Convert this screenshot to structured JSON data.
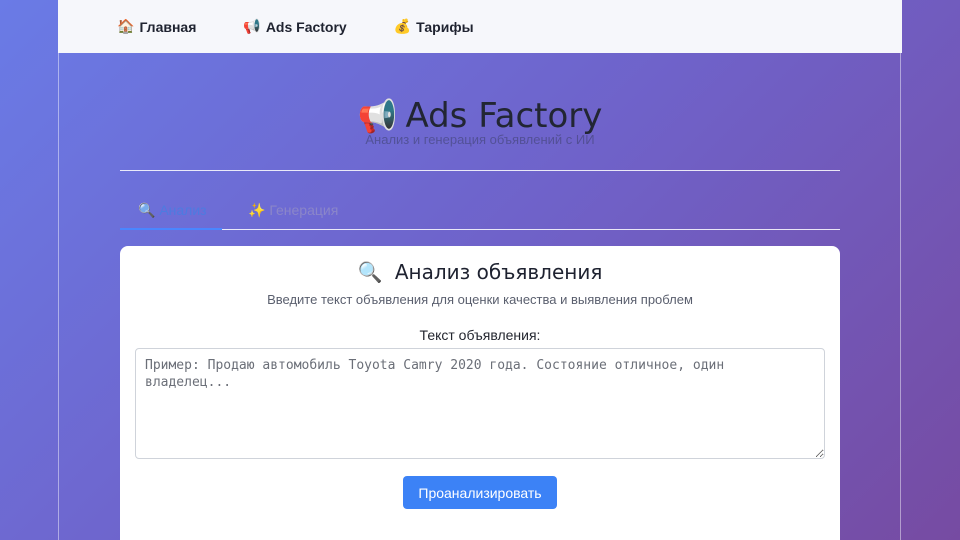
{
  "nav": {
    "items": [
      {
        "icon": "🏠",
        "icon_name": "home-icon",
        "label": "Главная"
      },
      {
        "icon": "📢",
        "icon_name": "megaphone-icon",
        "label": "Ads Factory"
      },
      {
        "icon": "💰",
        "icon_name": "money-bag-icon",
        "label": "Тарифы"
      }
    ]
  },
  "hero": {
    "icon": "📢",
    "title": "Ads Factory",
    "subtitle": "Анализ и генерация объявлений с ИИ"
  },
  "tabs": [
    {
      "icon": "🔍",
      "label": "Анализ",
      "active": true
    },
    {
      "icon": "✨",
      "label": "Генерация",
      "active": false
    }
  ],
  "card": {
    "icon": "🔍",
    "title": "Анализ объявления",
    "description": "Введите текст объявления для оценки качества и выявления проблем",
    "field_label": "Текст объявления:",
    "textarea_value": "",
    "textarea_placeholder": "Пример: Продаю автомобиль Toyota Camry 2020 года. Состояние отличное, один владелец...",
    "button_label": "Проанализировать"
  },
  "colors": {
    "gradient_start": "#6a7be6",
    "gradient_end": "#764ba2",
    "accent": "#3c82f6",
    "active_tab": "#4d7be0"
  }
}
